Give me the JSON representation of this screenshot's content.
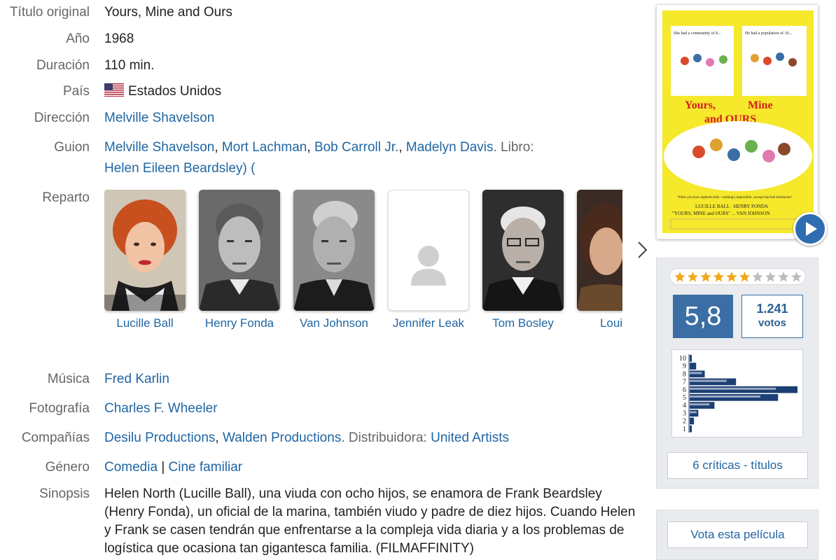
{
  "labels": {
    "titulo_original": "Título original",
    "anio": "Año",
    "duracion": "Duración",
    "pais": "País",
    "direccion": "Dirección",
    "guion": "Guion",
    "reparto": "Reparto",
    "musica": "Música",
    "fotografia": "Fotografía",
    "companias": "Compañías",
    "genero": "Género",
    "sinopsis": "Sinopsis"
  },
  "movie": {
    "titulo_original": "Yours, Mine and Ours",
    "anio": "1968",
    "duracion": "110 min.",
    "pais": "Estados Unidos",
    "direccion": "Melville Shavelson",
    "guion": {
      "writers": [
        "Melville Shavelson",
        "Mort Lachman",
        "Bob Carroll Jr.",
        "Madelyn Davis"
      ],
      "libro_label": ". Libro:",
      "libro": "Helen Eileen Beardsley) ("
    },
    "reparto": [
      "Lucille Ball",
      "Henry Fonda",
      "Van Johnson",
      "Jennifer Leak",
      "Tom Bosley",
      "Louise"
    ],
    "musica": "Fred Karlin",
    "fotografia": "Charles F. Wheeler",
    "companias": [
      "Desilu Productions",
      "Walden Productions"
    ],
    "distribuidora_label": ". Distribuidora:",
    "distribuidora": "United Artists",
    "genero": [
      "Comedia",
      "Cine familiar"
    ],
    "genero_sep": "|",
    "sinopsis": "Helen North (Lucille Ball), una viuda con ocho hijos, se enamora de Frank Beardsley (Henry Fonda), un oficial de la marina, también viudo y padre de diez hijos. Cuando Helen y Frank se casen tendrán que enfrentarse a la compleja vida diaria y a los problemas de logística que ocasiona tan gigantesca familia. (FILMAFFINITY)"
  },
  "poster": {
    "top_left_text": "She had a community of 8...",
    "top_right_text": "He had a population of 10...",
    "title_line1": "Yours,",
    "title_line2": "Mine",
    "title_line3": "and OURS",
    "tagline": "When you have eighteen kids—nothing's impossible...except hair'mal intimacies!",
    "credits_line1": "LUCILLE BALL · HENRY FONDA",
    "credits_line2": "\"YOURS, MINE and OURS\" ... VAN JOHNSON"
  },
  "rating": {
    "score": "5,8",
    "votes_count": "1.241",
    "votes_label": "votos",
    "stars_filled": 6,
    "stars_total": 10,
    "critics_button": "6 críticas - títulos",
    "vote_button": "Vota esta película"
  },
  "histogram": {
    "labels": [
      "10",
      "9",
      "8",
      "7",
      "6",
      "5",
      "4",
      "3",
      "2",
      "1"
    ],
    "values": [
      2,
      6,
      14,
      43,
      100,
      82,
      23,
      8,
      4,
      2
    ]
  },
  "colors": {
    "link": "#1f66a3",
    "score_bg": "#3a6ea5",
    "star_on": "#f0a81c",
    "star_off": "#bdbdbd",
    "poster_yellow": "#f6e82b"
  }
}
